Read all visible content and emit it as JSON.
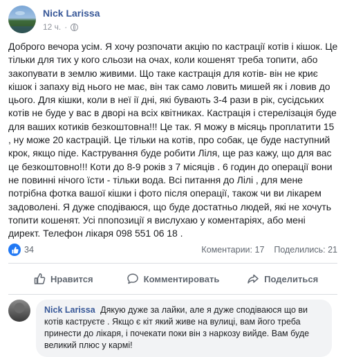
{
  "post": {
    "author": "Nick Larissa",
    "time": "12 ч.",
    "paragraphs": [
      "Доброго вечора усім. Я хочу розпочати акцію по кастрації котів і кішок. Це тільки для тих у кого сльози на очах, коли кошенят треба топити, або закопувати в землю живими. Що таке кастрація для котів- він не криє кішок і запаху від нього не має, він так само ловить мишей як і ловив до цього. Для кішки, коли в неї ії дні, які бувають 3-4 рази в рік, сусідських котів не буде у вас в дворі на всіх квітниках. Кастрація і стерелізація буде для ваших котиків безкоштовна!!! Це так. Я можу в місяць проплатити 15 , ну може 20 кастрацій. Це тільки на котів, про собак, це буде наступний крок, якщо піде. Кастрування буде робити Ліля, ще раз кажу, що для вас це безкоштовно!!! Коти до 8-9 років з 7 місяців . 6 годин до операції вони не повинні нічого їсти - тільки вода. Всі питання до Лілі , для мене потрібна фотка вашої кішки і фото після операції, також чи ви лікарем задоволені. Я дуже сподіваюся, що буде достатньо людей, які не хочуть топити кошенят. Усі ппопозиції я вислухаю у коментаріях, або мені директ. Телефон лікаря 098 551 06 18 ."
    ],
    "like_count": "34",
    "comments_label": "Коментарии: 17",
    "shares_label": "Поделились: 21"
  },
  "actions": {
    "like": "Нравится",
    "comment": "Комментировать",
    "share": "Поделиться"
  },
  "comment": {
    "author": "Nick Larissa",
    "text": "Дякую дуже за лайки, але я дуже сподіваюся що ви котів каструєте . Якщо є кіт який живе на вулиці, вам його треба принести до лікаря, і почекати поки він з наркозу вийде. Вам буде великий плюс у кармі!"
  },
  "colors": {
    "link_blue": "#385898",
    "like_blue": "#2078f4",
    "muted": "#606770"
  },
  "icons": {
    "privacy": "globe-icon",
    "reaction": "like-icon",
    "like_action": "thumbs-up-icon",
    "comment_action": "speech-bubble-icon",
    "share_action": "share-arrow-icon"
  }
}
